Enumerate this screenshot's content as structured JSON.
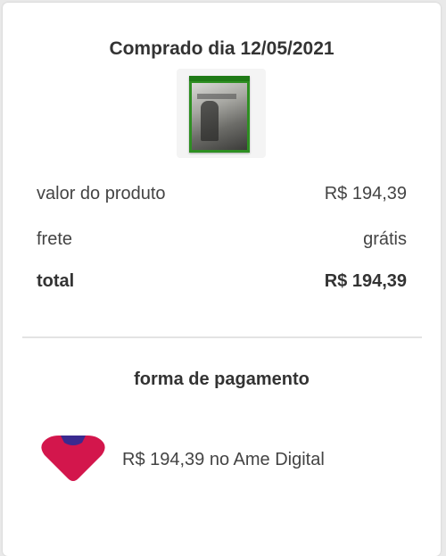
{
  "purchase": {
    "title": "Comprado dia 12/05/2021"
  },
  "product": {
    "image_icon": "game-cover-image"
  },
  "summary": {
    "product_label": "valor do produto",
    "product_value": "R$ 194,39",
    "shipping_label": "frete",
    "shipping_value": "grátis",
    "total_label": "total",
    "total_value": "R$ 194,39"
  },
  "payment": {
    "title": "forma de pagamento",
    "method_text": "R$ 194,39 no Ame Digital",
    "icon": "ame-digital-icon",
    "icon_colors": {
      "primary": "#d3164c",
      "accent": "#3a2a8f"
    }
  }
}
